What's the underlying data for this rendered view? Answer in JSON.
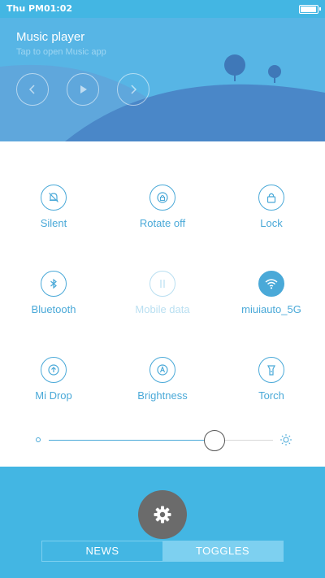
{
  "status_bar": {
    "time": "Thu PM01:02",
    "battery_level": 1.0
  },
  "music": {
    "title": "Music player",
    "subtitle": "Tap to open Music app",
    "prev_icon": "chevron-left-icon",
    "play_icon": "play-icon",
    "next_icon": "chevron-right-icon"
  },
  "toggles": [
    {
      "label": "Silent",
      "icon": "bell-off-icon",
      "state": "off"
    },
    {
      "label": "Rotate off",
      "icon": "rotate-lock-icon",
      "state": "off"
    },
    {
      "label": "Lock",
      "icon": "lock-icon",
      "state": "off"
    },
    {
      "label": "Bluetooth",
      "icon": "bluetooth-icon",
      "state": "off"
    },
    {
      "label": "Mobile data",
      "icon": "mobile-data-icon",
      "state": "disabled"
    },
    {
      "label": "miuiauto_5G",
      "icon": "wifi-icon",
      "state": "on"
    },
    {
      "label": "Mi Drop",
      "icon": "mi-drop-icon",
      "state": "off"
    },
    {
      "label": "Brightness",
      "icon": "brightness-auto-icon",
      "state": "off"
    },
    {
      "label": "Torch",
      "icon": "flashlight-icon",
      "state": "off"
    }
  ],
  "brightness_slider": {
    "value": 0.74,
    "min_icon": "dim-icon",
    "max_icon": "sun-icon"
  },
  "bottom": {
    "settings_icon": "gear-icon",
    "tabs": [
      "NEWS",
      "TOGGLES"
    ],
    "active_tab": "TOGGLES"
  },
  "colors": {
    "accent": "#4aa9d8",
    "bar_blue": "#43b6e3",
    "hill_dark": "#4a87c8",
    "gear_bg": "#6b6b6b"
  }
}
